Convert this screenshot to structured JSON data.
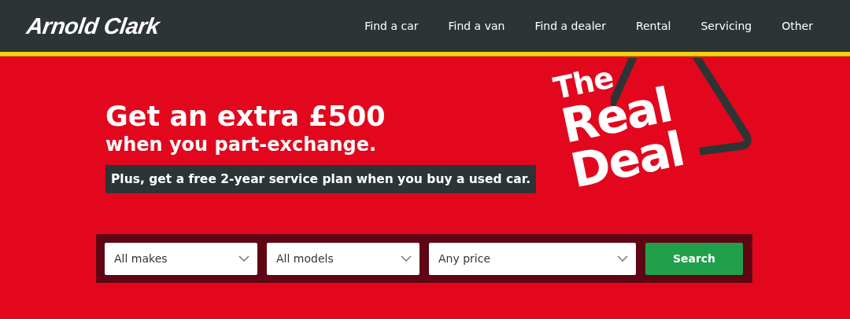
{
  "header": {
    "logo": "Arnold Clark",
    "nav": [
      {
        "label": "Find a car"
      },
      {
        "label": "Find a van"
      },
      {
        "label": "Find a dealer"
      },
      {
        "label": "Rental"
      },
      {
        "label": "Servicing"
      },
      {
        "label": "Other"
      }
    ]
  },
  "hero": {
    "headline": "Get an extra £500",
    "subheadline": "when you part-exchange.",
    "note": "Plus, get a free 2-year service plan when you buy a used car.",
    "badge": [
      "The",
      "Real",
      "Deal"
    ]
  },
  "search": {
    "selects": [
      {
        "value": "All makes"
      },
      {
        "value": "All models"
      },
      {
        "value": "Any price"
      }
    ],
    "button": "Search"
  }
}
